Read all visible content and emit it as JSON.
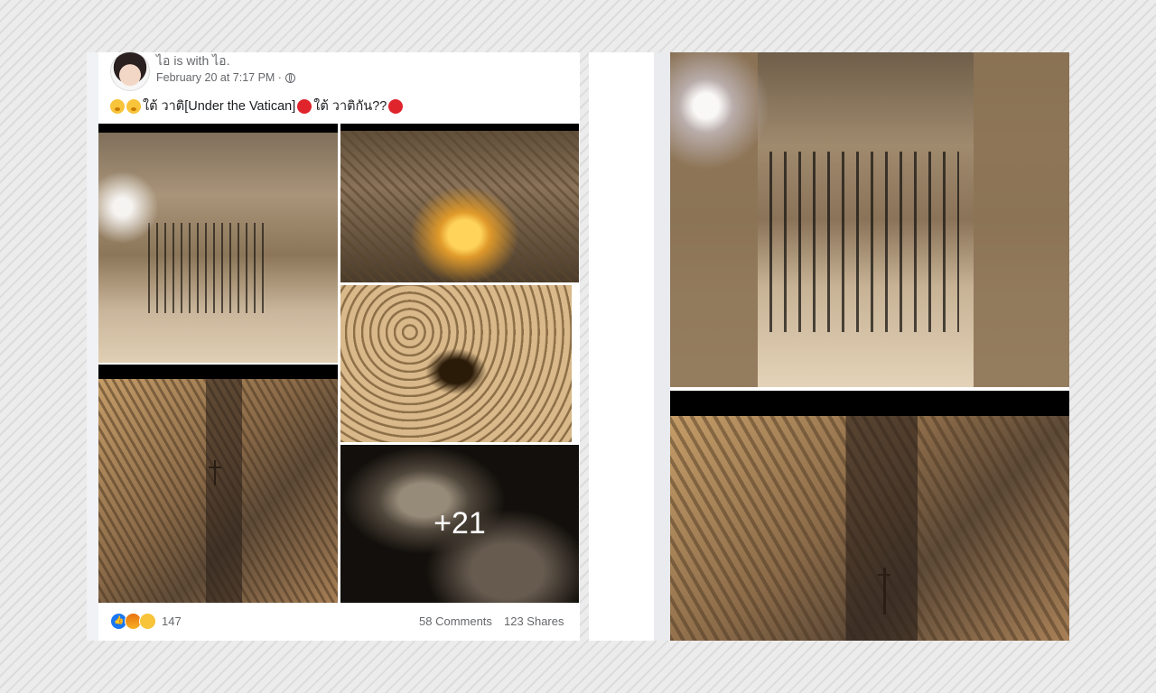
{
  "post": {
    "author_line": "ไอ is with ไอ.",
    "date": "February 20 at 7:17 PM ·",
    "text_part1": "ใต้ วาติ[Under the Vatican]",
    "text_part2": "ใต้ วาติกัน??",
    "more_photos": "+21"
  },
  "photos": [
    {
      "name": "catacomb-corridor-gate"
    },
    {
      "name": "bone-chapel-altar"
    },
    {
      "name": "skull-wall-niche"
    },
    {
      "name": "bone-vault-cross"
    },
    {
      "name": "skeleton-closeup"
    }
  ],
  "footer": {
    "reaction_count": "147",
    "comments": "58 Comments",
    "shares": "123 Shares"
  },
  "reaction_icons": [
    "like-icon",
    "angry-icon",
    "sad-icon"
  ],
  "colors": {
    "meta_text": "#65676b",
    "body_text": "#1c1e21",
    "like_blue": "#1877f2",
    "red_circle": "#e0242c"
  }
}
